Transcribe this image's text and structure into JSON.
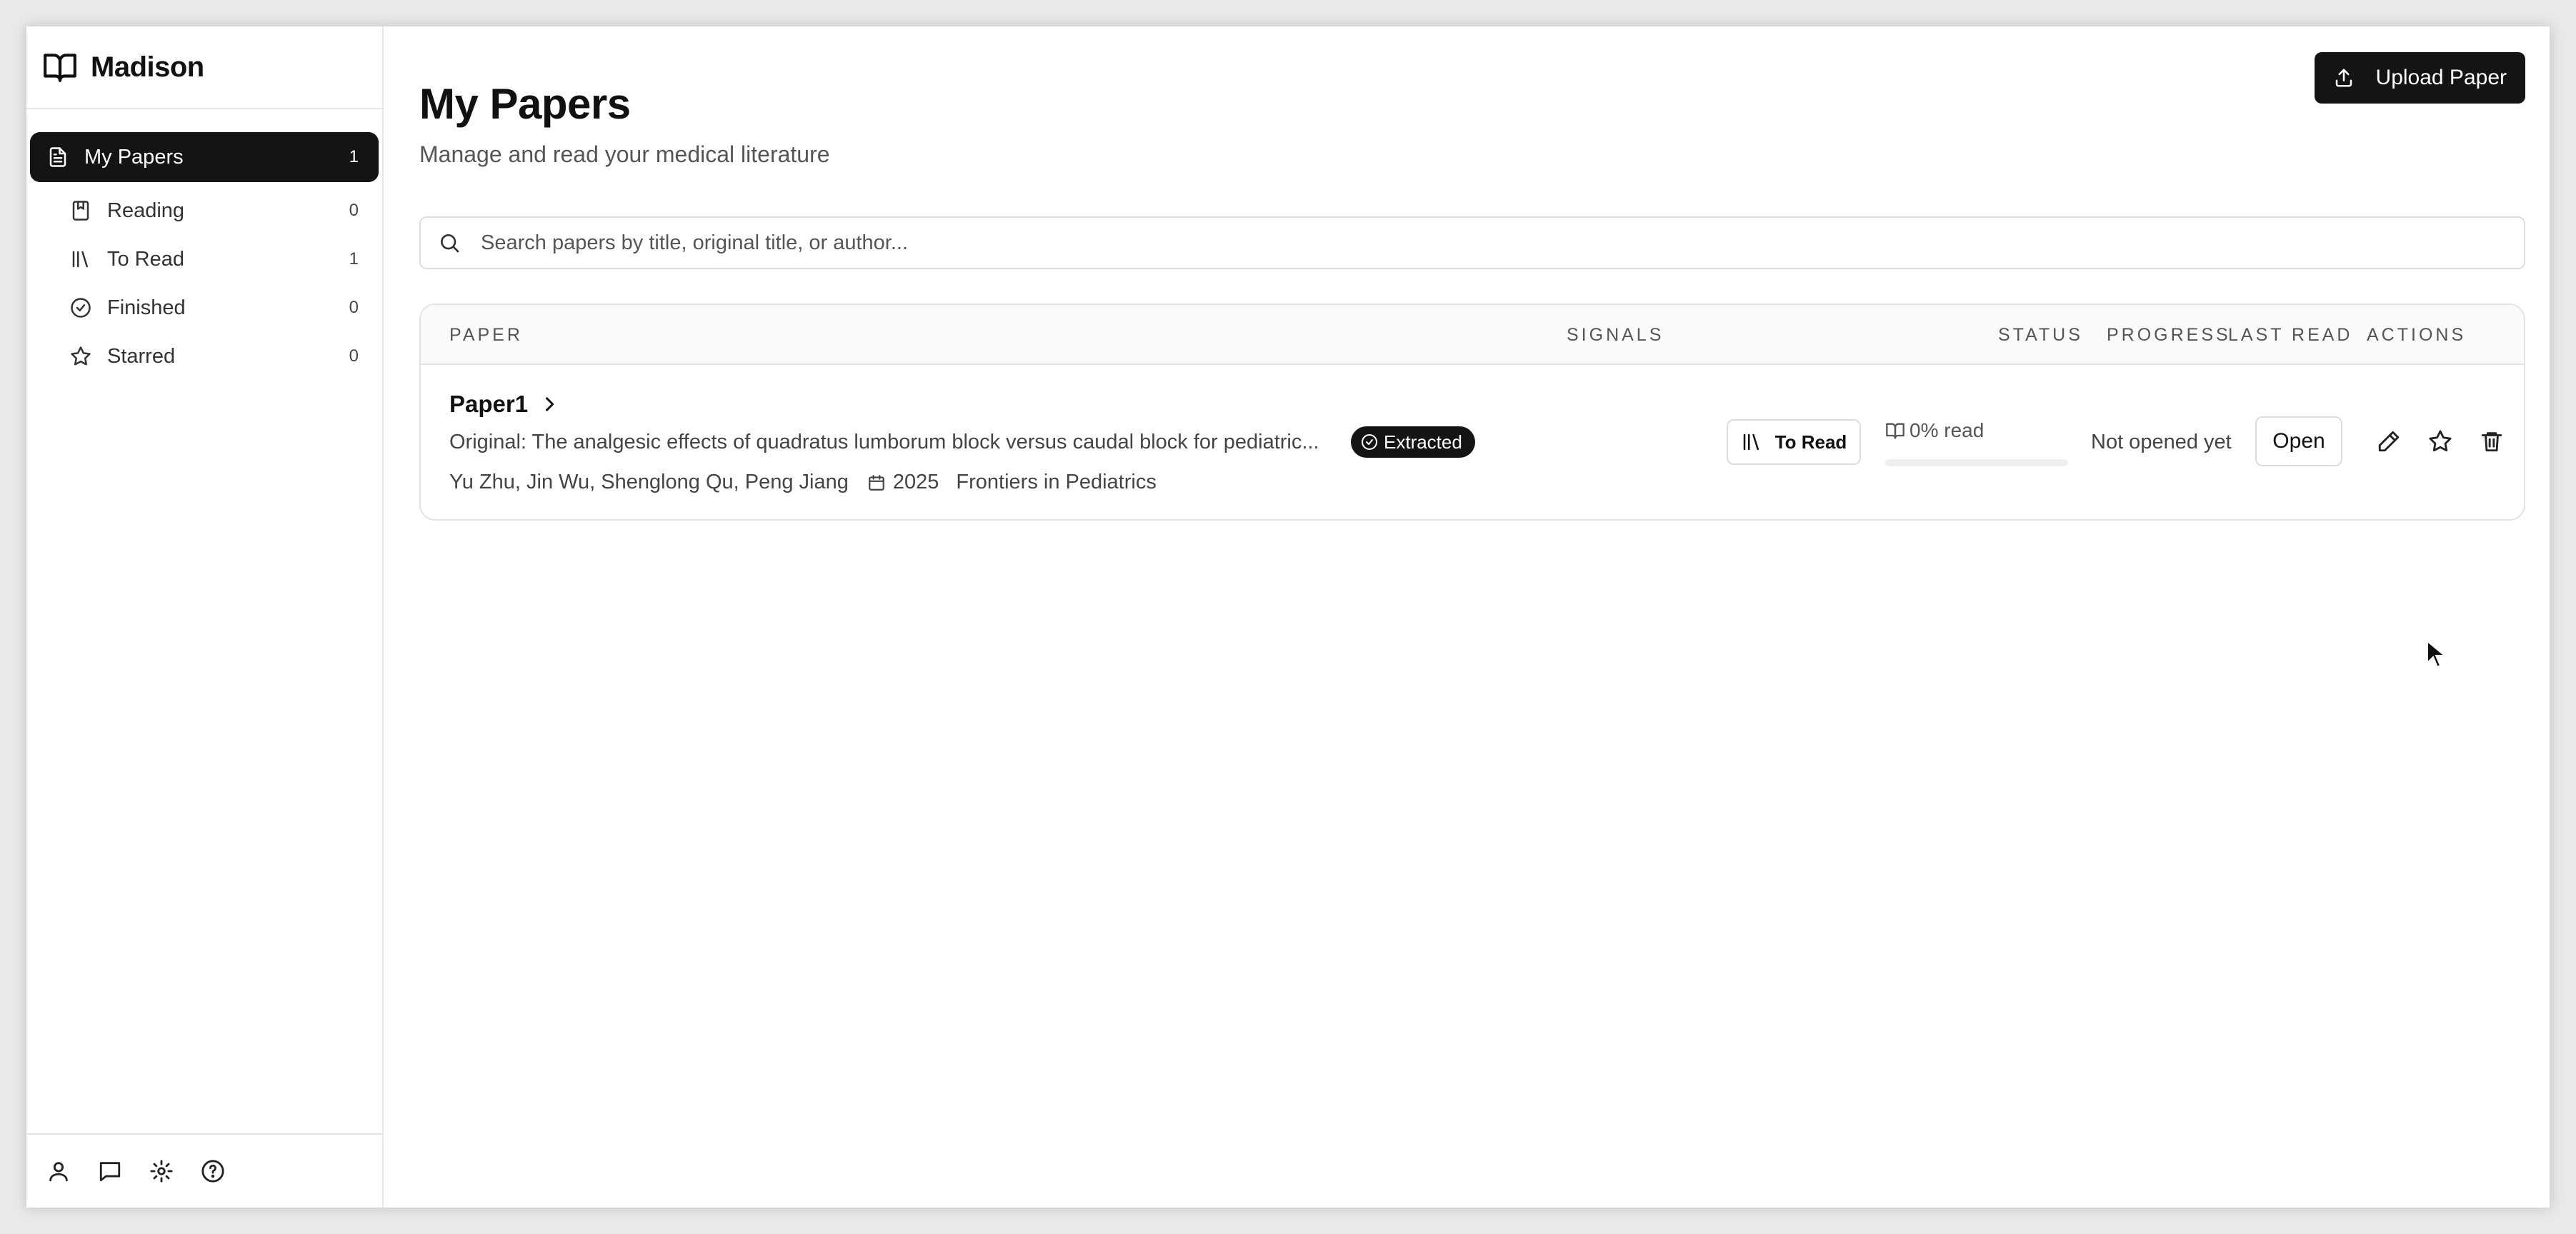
{
  "app": {
    "name": "Madison"
  },
  "sidebar": {
    "items": [
      {
        "label": "My Papers",
        "count": "1"
      },
      {
        "label": "Reading",
        "count": "0"
      },
      {
        "label": "To Read",
        "count": "1"
      },
      {
        "label": "Finished",
        "count": "0"
      },
      {
        "label": "Starred",
        "count": "0"
      }
    ],
    "footer_icons": [
      "user-icon",
      "chat-icon",
      "gear-icon",
      "help-icon"
    ]
  },
  "header": {
    "title": "My Papers",
    "subtitle": "Manage and read your medical literature",
    "upload_label": "Upload Paper"
  },
  "search": {
    "placeholder": "Search papers by title, original title, or author...",
    "value": ""
  },
  "table": {
    "columns": {
      "paper": "PAPER",
      "signals": "SIGNALS",
      "status": "STATUS",
      "progress": "PROGRESS",
      "last_read": "LAST READ",
      "actions": "ACTIONS"
    },
    "rows": [
      {
        "title": "Paper1",
        "original": "Original: The analgesic effects of quadratus lumborum block versus caudal block for pediatric...",
        "authors": "Yu Zhu, Jin Wu, Shenglong Qu, Peng Jiang",
        "year": "2025",
        "journal": "Frontiers in Pediatrics",
        "signal_badge": "Extracted",
        "status": "To Read",
        "progress_label": "0% read",
        "progress_percent": 0,
        "last_read": "Not opened yet",
        "open_label": "Open"
      }
    ]
  },
  "colors": {
    "primary": "#141414",
    "border": "#e3e3e3",
    "muted_text": "#555555"
  }
}
